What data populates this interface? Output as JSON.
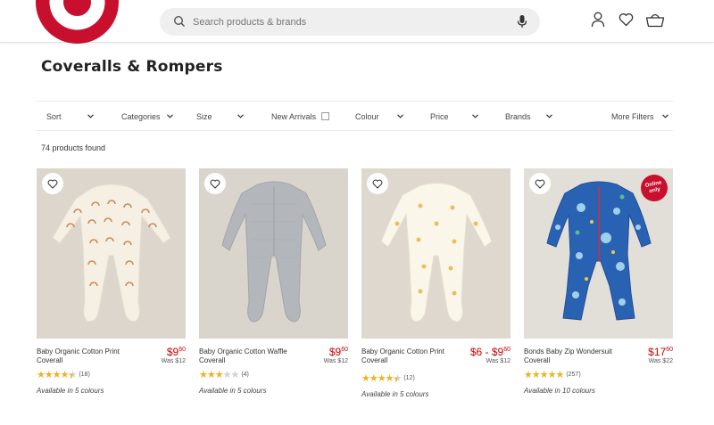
{
  "header": {
    "search_placeholder": "Search products & brands",
    "brand_color": "#c8102e",
    "icons": [
      "search-icon",
      "microphone-icon",
      "account-icon",
      "wishlist-heart-icon",
      "cart-basket-icon"
    ]
  },
  "page_title": "Coveralls & Rompers",
  "filters": [
    {
      "label": "Sort",
      "type": "dropdown"
    },
    {
      "label": "Categories",
      "type": "dropdown"
    },
    {
      "label": "Size",
      "type": "dropdown"
    },
    {
      "label": "New Arrivals",
      "type": "checkbox"
    },
    {
      "label": "Colour",
      "type": "dropdown"
    },
    {
      "label": "Price",
      "type": "dropdown"
    },
    {
      "label": "Brands",
      "type": "dropdown"
    },
    {
      "label": "More Filters",
      "type": "dropdown"
    }
  ],
  "result_count": "74 products found",
  "products": [
    {
      "name": "Baby Organic Cotton Print Coverall",
      "price_main": "$9",
      "price_cents": "60",
      "was": "Was $12",
      "rating": 4.5,
      "reviews": "(18)",
      "colours": "Available in 5 colours",
      "badge": ""
    },
    {
      "name": "Baby Organic Cotton Waffle Coverall",
      "price_main": "$9",
      "price_cents": "60",
      "was": "Was $12",
      "rating": 3,
      "reviews": "(4)",
      "colours": "Available in 5 colours",
      "badge": ""
    },
    {
      "name": "Baby Organic Cotton Print Coverall",
      "price_main": "$6 - $9",
      "price_cents": "60",
      "was": "Was $12",
      "rating": 4.5,
      "reviews": "(12)",
      "colours": "Available in 5 colours",
      "badge": ""
    },
    {
      "name": "Bonds Baby Zip Wondersuit Coverall",
      "price_main": "$17",
      "price_cents": "60",
      "was": "Was $22",
      "rating": 5,
      "reviews": "(257)",
      "colours": "Available in 10 colours",
      "badge": "Online only"
    }
  ]
}
